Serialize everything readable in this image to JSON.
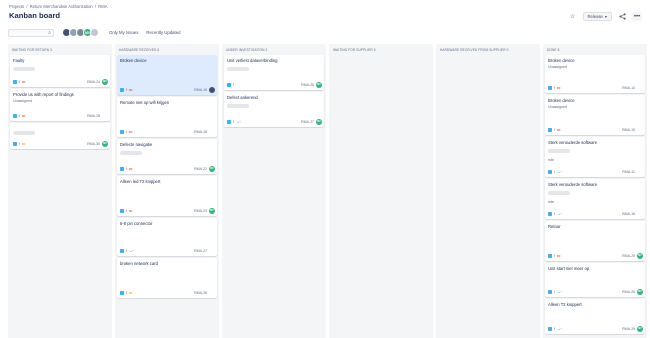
{
  "breadcrumb": [
    "Projects",
    "Return Merchandise Authorization",
    "RMA"
  ],
  "breadcrumb_sep": "/",
  "page_title": "Kanban board",
  "header": {
    "release_label": "Release",
    "star_icon": "star-icon",
    "share_icon": "share-icon",
    "more_icon": "more-icon"
  },
  "toolbar": {
    "search_placeholder": "",
    "only_my_issues": "Only My Issues",
    "recently_updated": "Recently Updated",
    "avatars": [
      {
        "initials": "",
        "color": "#42526e"
      },
      {
        "initials": "",
        "color": "#97a0af"
      },
      {
        "initials": "",
        "color": "#7a869a"
      },
      {
        "initials": "MV",
        "color": "#36b37e"
      },
      {
        "initials": "",
        "color": "#c1c7d0"
      }
    ]
  },
  "colors": {
    "accent": "#0052cc",
    "avatar_green": "#36b37e",
    "priority_high": "#de350b",
    "priority_medium": "#ff8b00",
    "priority_low": "#0065ff"
  },
  "columns": [
    {
      "header": "WAITING FOR RETURN 3",
      "cards": [
        {
          "title": "Faulty",
          "sub": "",
          "blur": true,
          "key": "RMA-24",
          "priority": "high",
          "avatar": "MV",
          "height": 32
        },
        {
          "title": "Provide us with report of findings",
          "sub": "Unassigned",
          "blur": false,
          "key": "RMA-28",
          "priority": "high",
          "avatar": "",
          "height": 32
        },
        {
          "title": "",
          "sub": "",
          "blur": true,
          "key": "RMA-30",
          "priority": "med",
          "avatar": "MV",
          "height": 26
        }
      ]
    },
    {
      "header": "HARDWARE RECEIVED 6",
      "cards": [
        {
          "title": "Broken device",
          "sub": "",
          "blur": false,
          "key": "RMA-19",
          "priority": "high",
          "avatar": "photo",
          "height": 40,
          "selected": true
        },
        {
          "title": "Remote niet op wifi krijgen",
          "sub": "",
          "blur": false,
          "key": "RMA-18",
          "priority": "high",
          "avatar": "",
          "height": 40
        },
        {
          "title": "Defecte navigatie",
          "sub": "",
          "blur": true,
          "key": "RMA-22",
          "priority": "high",
          "avatar": "MV",
          "height": 35
        },
        {
          "title": "Alleen led T2 knippert",
          "sub": "",
          "blur": false,
          "key": "RMA-23",
          "priority": "high",
          "avatar": "MV",
          "height": 40
        },
        {
          "title": "6-8 pin connector",
          "sub": "",
          "blur": false,
          "key": "RMA-27",
          "priority": "low",
          "avatar": "",
          "height": 38
        },
        {
          "title": "broken network card",
          "sub": "",
          "blur": false,
          "key": "RMA-26",
          "priority": "med",
          "avatar": "",
          "height": 40
        }
      ]
    },
    {
      "header": "UNDER INVESTIGATION 2",
      "cards": [
        {
          "title": "Unit verliest dataverbinding",
          "sub": "",
          "blur": true,
          "key": "RMA-25",
          "priority": "",
          "avatar": "MV",
          "height": 35
        },
        {
          "title": "Defect ankerend",
          "sub": "",
          "blur": true,
          "key": "RMA-27",
          "priority": "low",
          "avatar": "MV",
          "height": 35
        }
      ]
    },
    {
      "header": "WAITING FOR SUPPLIER 0",
      "cards": []
    },
    {
      "header": "HARDWARE RECEIVED FROM SUPPLIER 0",
      "cards": []
    },
    {
      "header": "DONE 8",
      "cards": [
        {
          "title": "Broken device",
          "sub": "Unassigned",
          "blur": false,
          "key": "RMA-14",
          "priority": "high",
          "avatar": "",
          "height": 38
        },
        {
          "title": "Broken device",
          "sub": "Unassigned",
          "blur": false,
          "key": "RMA-15",
          "priority": "high",
          "avatar": "",
          "height": 40
        },
        {
          "title": "Sterk verouderde software",
          "sub": "nde",
          "blur": true,
          "key": "RMA-11",
          "priority": "low",
          "avatar": "",
          "height": 40
        },
        {
          "title": "Sterk verouderde software",
          "sub": "nde",
          "blur": true,
          "key": "RMA-16",
          "priority": "low",
          "avatar": "",
          "height": 40
        },
        {
          "title": "Retour",
          "sub": "",
          "blur": false,
          "key": "RMA-20",
          "priority": "high",
          "avatar": "MV",
          "height": 40
        },
        {
          "title": "Unit start niet meer op",
          "sub": "",
          "blur": false,
          "key": "RMA-26",
          "priority": "low",
          "avatar": "MV",
          "height": 34
        },
        {
          "title": "Alleen T2 knippert",
          "sub": "",
          "blur": false,
          "key": "RMA-29",
          "priority": "low",
          "avatar": "MV",
          "height": 35
        }
      ]
    }
  ]
}
